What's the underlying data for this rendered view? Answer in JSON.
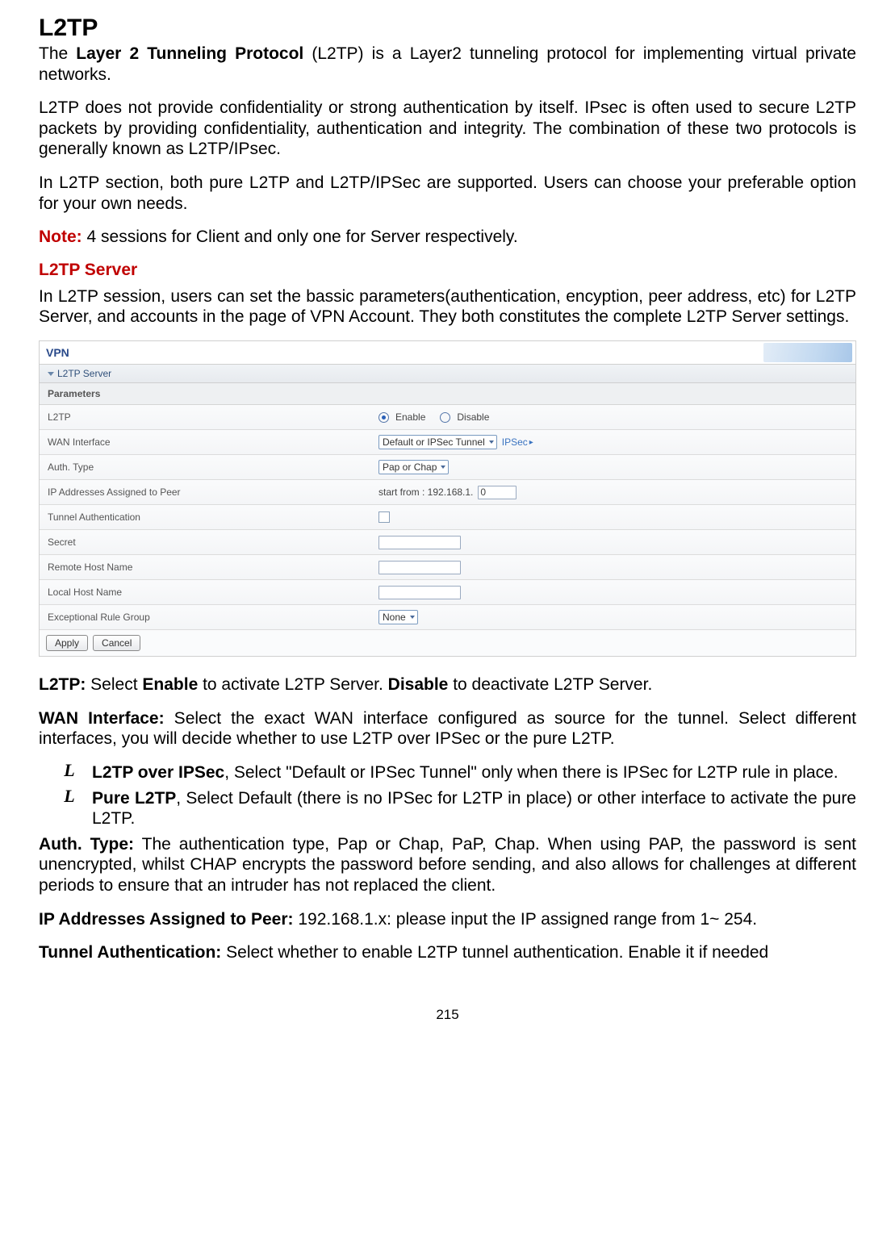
{
  "title": "L2TP",
  "intro_1a": "The ",
  "intro_1b": "Layer 2 Tunneling Protocol",
  "intro_1c": " (L2TP) is a Layer2 tunneling protocol for implementing virtual private networks.",
  "intro_2": "L2TP does not provide confidentiality or strong authentication by itself. IPsec is often used to secure L2TP packets by providing confidentiality, authentication and integrity. The combination of these two protocols is generally known as L2TP/IPsec.",
  "intro_3": "In L2TP section, both pure L2TP and L2TP/IPSec are supported. Users can choose your preferable option for your own needs.",
  "note_label": "Note:",
  "note_text": " 4 sessions for Client and only one for Server respectively.",
  "section_title": "L2TP Server",
  "section_intro": "In L2TP session, users can set the bassic parameters(authentication, encyption, peer address, etc) for L2TP Server, and accounts in the page of VPN Account. They both constitutes the complete L2TP Server settings.",
  "panel": {
    "header": "VPN",
    "subheader": "L2TP Server",
    "params": "Parameters",
    "rows": {
      "l2tp": {
        "label": "L2TP",
        "opt_enable": "Enable",
        "opt_disable": "Disable"
      },
      "wan": {
        "label": "WAN Interface",
        "value": "Default or IPSec Tunnel",
        "link": "IPSec"
      },
      "auth": {
        "label": "Auth. Type",
        "value": "Pap or Chap"
      },
      "ip": {
        "label": "IP Addresses Assigned to Peer",
        "prefix": "start from : 192.168.1.",
        "value": "0"
      },
      "tunnel": {
        "label": "Tunnel Authentication"
      },
      "secret": {
        "label": "Secret"
      },
      "remote": {
        "label": "Remote Host Name"
      },
      "local": {
        "label": "Local Host Name"
      },
      "exc": {
        "label": "Exceptional Rule Group",
        "value": "None"
      }
    },
    "btn_apply": "Apply",
    "btn_cancel": "Cancel"
  },
  "desc": {
    "l2tp_a": "L2TP:",
    "l2tp_b": " Select ",
    "l2tp_c": "Enable",
    "l2tp_d": " to activate L2TP Server. ",
    "l2tp_e": "Disable",
    "l2tp_f": " to deactivate L2TP Server.",
    "wan_a": "WAN Interface:",
    "wan_b": " Select the exact WAN interface configured as source for the tunnel. Select different interfaces, you will decide whether to use L2TP over IPSec or the pure L2TP.",
    "li1_a": "L2TP over IPSec",
    "li1_b": ", Select \"Default or IPSec Tunnel\" only when there is IPSec for L2TP rule in place.",
    "li2_a": "Pure L2TP",
    "li2_b": ", Select Default (there is no IPSec for L2TP in place) or other interface to activate the pure L2TP.",
    "auth_a": "Auth. Type:",
    "auth_b": " The authentication type, Pap or Chap, PaP, Chap. When using PAP, the password is sent unencrypted, whilst CHAP encrypts the password before sending, and also allows for challenges at different periods to ensure that an intruder has not replaced the client.",
    "ip_a": "IP Addresses Assigned to Peer:",
    "ip_b": " 192.168.1.x: please input the IP assigned range from 1~ 254.",
    "tun_a": "Tunnel Authentication:",
    "tun_b": " Select whether to enable L2TP tunnel authentication. Enable it if needed"
  },
  "info_icon": "L",
  "page_number": "215"
}
